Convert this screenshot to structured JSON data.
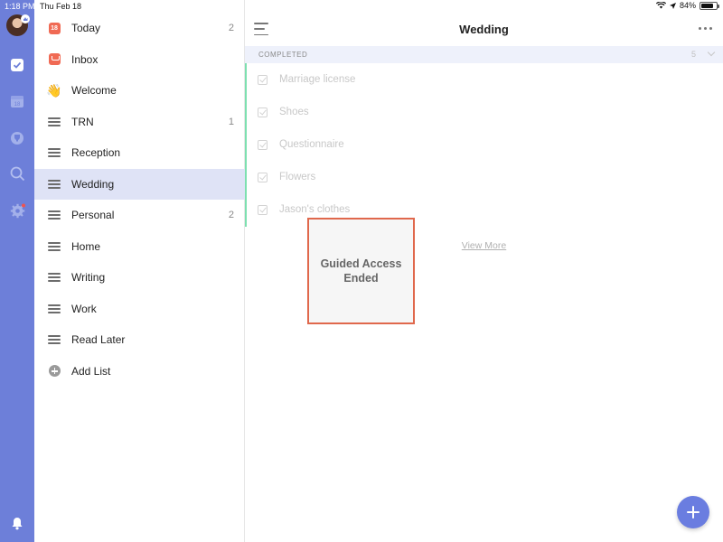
{
  "status_bar": {
    "time": "1:18 PM",
    "date": "Thu Feb 18",
    "battery": "84%",
    "battery_level": 0.84
  },
  "rail": {
    "items": [
      {
        "name": "tasks",
        "icon": "checkbox-icon",
        "active": true
      },
      {
        "name": "calendar",
        "icon": "calendar-icon",
        "day": "18"
      },
      {
        "name": "habits",
        "icon": "trophy-icon"
      },
      {
        "name": "search",
        "icon": "search-icon"
      },
      {
        "name": "settings",
        "icon": "gear-icon",
        "badge": true
      },
      {
        "name": "notifications",
        "icon": "bell-icon"
      }
    ]
  },
  "sidebar": {
    "items": [
      {
        "label": "Today",
        "count": "2",
        "icon": "calendar-today-icon",
        "day": "18"
      },
      {
        "label": "Inbox",
        "count": "",
        "icon": "inbox-icon"
      },
      {
        "label": "Welcome",
        "count": "",
        "icon": "waving-hand-icon"
      },
      {
        "label": "TRN",
        "count": "1",
        "icon": "list-icon"
      },
      {
        "label": "Reception",
        "count": "",
        "icon": "list-icon"
      },
      {
        "label": "Wedding",
        "count": "",
        "icon": "list-icon",
        "active": true
      },
      {
        "label": "Personal",
        "count": "2",
        "icon": "list-icon"
      },
      {
        "label": "Home",
        "count": "",
        "icon": "list-icon"
      },
      {
        "label": "Writing",
        "count": "",
        "icon": "list-icon"
      },
      {
        "label": "Work",
        "count": "",
        "icon": "list-icon"
      },
      {
        "label": "Read Later",
        "count": "",
        "icon": "list-icon"
      },
      {
        "label": "Add List",
        "count": "",
        "icon": "add-circle-icon"
      }
    ]
  },
  "main": {
    "title": "Wedding",
    "section": {
      "title": "COMPLETED",
      "count": "5"
    },
    "tasks": [
      {
        "label": "Marriage license"
      },
      {
        "label": "Shoes"
      },
      {
        "label": "Questionnaire"
      },
      {
        "label": "Flowers"
      },
      {
        "label": "Jason's clothes"
      }
    ],
    "view_more": "View More"
  },
  "overlay": {
    "text": "Guided Access Ended"
  },
  "colors": {
    "rail": "#6d7fd9",
    "active_row": "#dfe3f6",
    "accent_red": "#f06a54",
    "completed_border": "#7de0b0",
    "fab": "#6a7de0",
    "overlay_border": "#e0684c"
  }
}
